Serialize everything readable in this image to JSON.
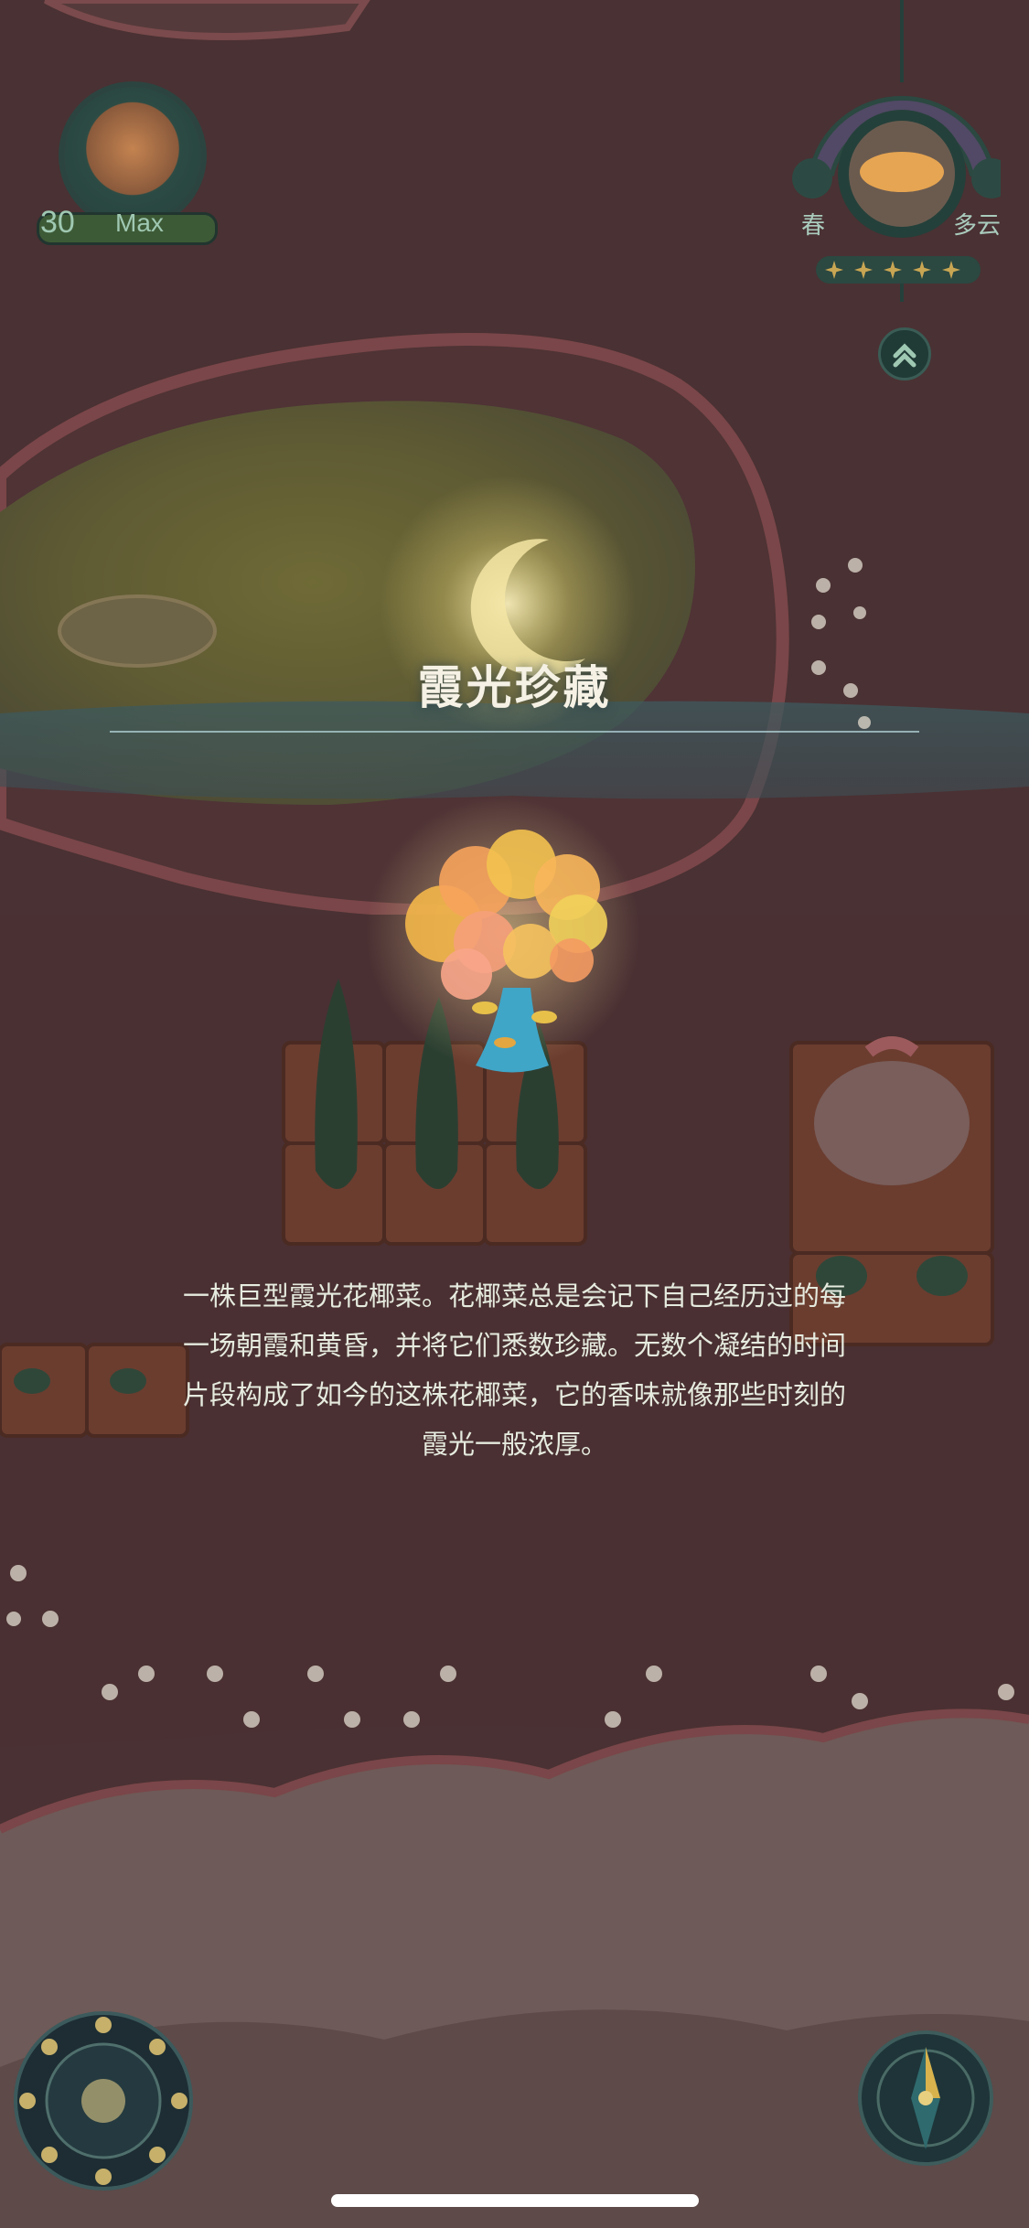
{
  "hud": {
    "player_level": "30",
    "level_status": "Max",
    "season": "春",
    "weather": "多云",
    "star_count": 5
  },
  "item_popup": {
    "title": "霞光珍藏",
    "description_lines": [
      "一株巨型霞光花椰菜。花椰菜总是会记下自己经历过的每",
      "一场朝霞和黄昏，并将它们悉数珍藏。无数个凝结的时间",
      "片段构成了如今的这株花椰菜，它的香味就像那些时刻的",
      "霞光一般浓厚。"
    ]
  },
  "icons": {
    "avatar": "cat-avatar-icon",
    "season_dial": "season-weather-dial-icon",
    "expand": "chevron-up-icon",
    "moon_menu": "moon-phase-menu-icon",
    "compass": "compass-icon",
    "item": "glowing-cauliflower-icon"
  },
  "colors": {
    "overlay_tint": "#5b3b3d",
    "title_text": "#f5f1e4",
    "desc_text": "#e6ebdf",
    "hud_text": "#a9cbbd",
    "glow_gold": "#f5d66a"
  }
}
